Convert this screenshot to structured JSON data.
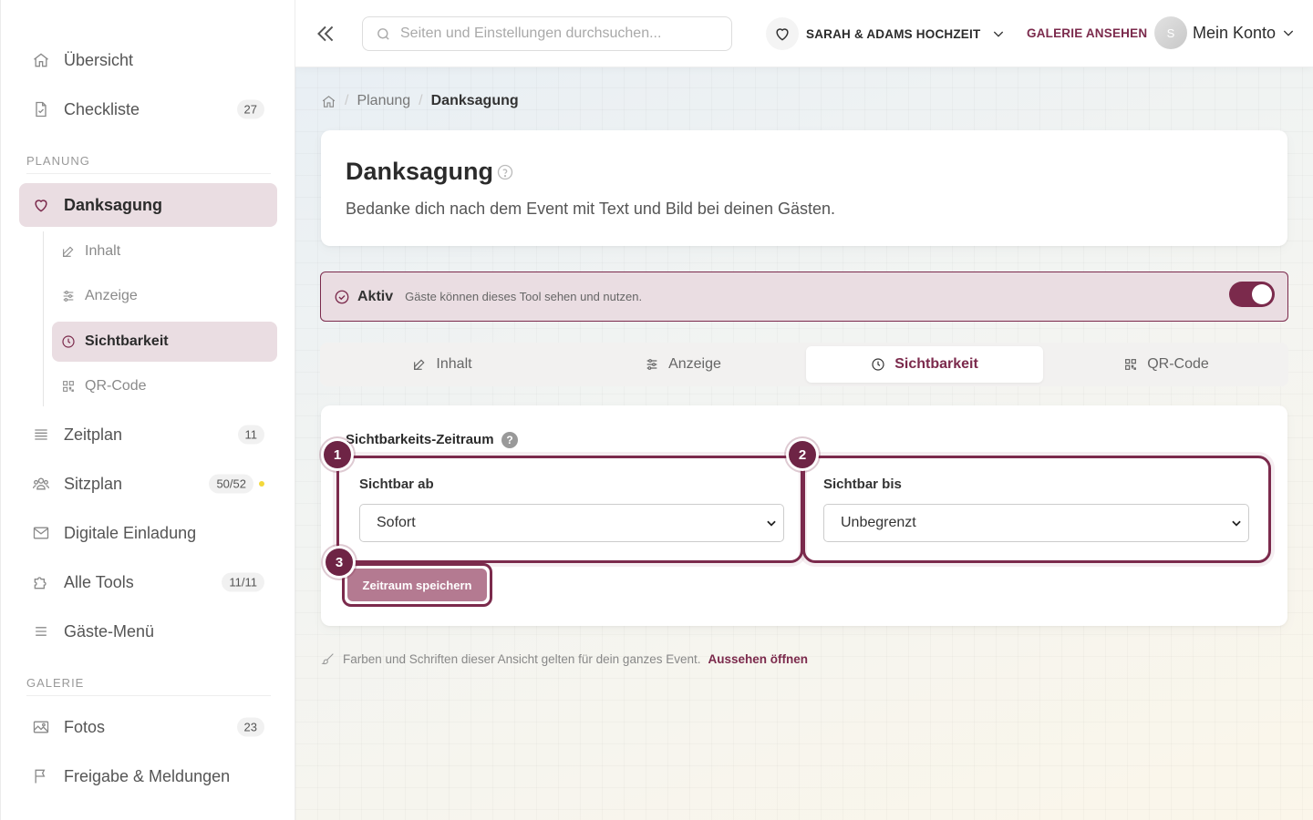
{
  "sidebar": {
    "items": [
      {
        "label": "Übersicht",
        "icon": "home-icon"
      },
      {
        "label": "Checkliste",
        "icon": "document-check-icon",
        "badge": "27"
      }
    ],
    "section_planung": "PLANUNG",
    "active_item": {
      "label": "Danksagung",
      "icon": "heart-icon"
    },
    "sub_items": [
      {
        "label": "Inhalt",
        "icon": "edit-icon"
      },
      {
        "label": "Anzeige",
        "icon": "sliders-icon"
      },
      {
        "label": "Sichtbarkeit",
        "icon": "clock-icon"
      },
      {
        "label": "QR-Code",
        "icon": "qr-code-icon"
      }
    ],
    "planung_items": [
      {
        "label": "Zeitplan",
        "icon": "list-icon",
        "badge": "11"
      },
      {
        "label": "Sitzplan",
        "icon": "users-icon",
        "badge": "50/52"
      },
      {
        "label": "Digitale Einladung",
        "icon": "mail-icon"
      },
      {
        "label": "Alle Tools",
        "icon": "puzzle-icon",
        "badge": "11/11"
      },
      {
        "label": "Gäste-Menü",
        "icon": "menu-icon"
      }
    ],
    "section_galerie": "GALERIE",
    "galerie_items": [
      {
        "label": "Fotos",
        "icon": "image-icon",
        "badge": "23"
      },
      {
        "label": "Freigabe & Meldungen",
        "icon": "flag-icon"
      }
    ]
  },
  "topbar": {
    "search_placeholder": "Seiten und Einstellungen durchsuchen...",
    "event_name": "SARAH & ADAMS HOCHZEIT",
    "gallery_link": "GALERIE ANSEHEN",
    "avatar_initial": "S",
    "account_label": "Mein Konto"
  },
  "breadcrumb": {
    "parent": "Planung",
    "current": "Danksagung"
  },
  "header": {
    "title": "Danksagung",
    "description": "Bedanke dich nach dem Event mit Text und Bild bei deinen Gästen."
  },
  "status": {
    "label": "Aktiv",
    "hint": "Gäste können dieses Tool sehen und nutzen.",
    "enabled": true
  },
  "tabs": [
    {
      "label": "Inhalt",
      "icon": "edit-icon"
    },
    {
      "label": "Anzeige",
      "icon": "sliders-icon"
    },
    {
      "label": "Sichtbarkeit",
      "icon": "clock-icon",
      "active": true
    },
    {
      "label": "QR-Code",
      "icon": "qr-code-icon"
    }
  ],
  "form": {
    "title": "Sichtbarkeits-Zeitraum",
    "visible_from": {
      "label": "Sichtbar ab",
      "value": "Sofort"
    },
    "visible_until": {
      "label": "Sichtbar bis",
      "value": "Unbegrenzt"
    },
    "save_label": "Zeitraum speichern",
    "steps": [
      "1",
      "2",
      "3"
    ]
  },
  "footer": {
    "note": "Farben und Schriften dieser Ansicht gelten für dein ganzes Event.",
    "link": "Aussehen öffnen"
  },
  "colors": {
    "accent": "#7b2a4c",
    "active_bg": "#eadde2",
    "button_disabled": "#b47a91"
  }
}
